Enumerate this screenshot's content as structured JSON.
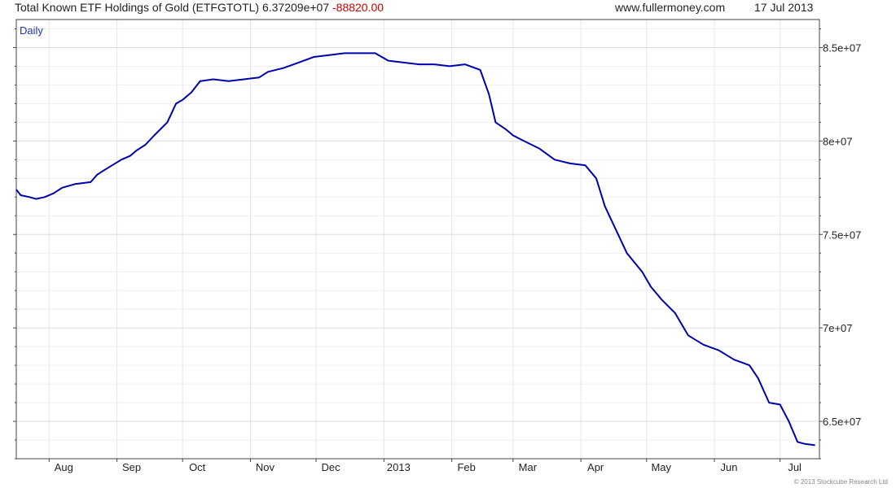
{
  "header": {
    "title": "Total Known ETF Holdings of Gold (ETFGTOTL)",
    "last_value": "6.37209e+07",
    "change": "-88820.00",
    "site": "www.fullermoney.com",
    "date": "17 Jul 2013"
  },
  "period_label": "Daily",
  "copyright": "© 2013 Stockcube Research Ltd",
  "colors": {
    "series": "#0000aa",
    "change": "#cc0000",
    "grid": "#e6e6e6",
    "axis": "#444444",
    "period_label": "#2233aa"
  },
  "chart_data": {
    "type": "line",
    "title": "Total Known ETF Holdings of Gold (ETFGTOTL)",
    "xlabel": "",
    "ylabel": "",
    "ylim": [
      63000000,
      86500000
    ],
    "xlim": [
      "2012-07-17",
      "2013-07-19"
    ],
    "y_axis_side": "right",
    "grid": true,
    "y_ticks": [
      {
        "value": 65000000,
        "label": "6.5e+07"
      },
      {
        "value": 70000000,
        "label": "7e+07"
      },
      {
        "value": 75000000,
        "label": "7.5e+07"
      },
      {
        "value": 80000000,
        "label": "8e+07"
      },
      {
        "value": 85000000,
        "label": "8.5e+07"
      }
    ],
    "x_ticks": [
      {
        "date": "2012-08-01",
        "label": "Aug"
      },
      {
        "date": "2012-09-01",
        "label": "Sep"
      },
      {
        "date": "2012-10-01",
        "label": "Oct"
      },
      {
        "date": "2012-11-01",
        "label": "Nov"
      },
      {
        "date": "2012-12-01",
        "label": "Dec"
      },
      {
        "date": "2013-01-01",
        "label": "2013"
      },
      {
        "date": "2013-02-01",
        "label": "Feb"
      },
      {
        "date": "2013-03-01",
        "label": "Mar"
      },
      {
        "date": "2013-04-01",
        "label": "Apr"
      },
      {
        "date": "2013-05-01",
        "label": "May"
      },
      {
        "date": "2013-06-01",
        "label": "Jun"
      },
      {
        "date": "2013-07-01",
        "label": "Jul"
      }
    ],
    "series": [
      {
        "x": [
          "2012-07-17",
          "2012-07-19",
          "2012-07-23",
          "2012-07-26",
          "2012-07-30",
          "2012-08-03",
          "2012-08-07",
          "2012-08-13",
          "2012-08-20",
          "2012-08-23",
          "2012-08-27",
          "2012-09-03",
          "2012-09-07",
          "2012-09-10",
          "2012-09-14",
          "2012-09-18",
          "2012-09-24",
          "2012-09-28",
          "2012-10-01",
          "2012-10-05",
          "2012-10-09",
          "2012-10-15",
          "2012-10-22",
          "2012-10-29",
          "2012-11-05",
          "2012-11-09",
          "2012-11-16",
          "2012-11-23",
          "2012-11-30",
          "2012-12-07",
          "2012-12-14",
          "2012-12-21",
          "2012-12-28",
          "2013-01-03",
          "2013-01-10",
          "2013-01-17",
          "2013-01-24",
          "2013-01-31",
          "2013-02-07",
          "2013-02-14",
          "2013-02-18",
          "2013-02-21",
          "2013-02-26",
          "2013-03-01",
          "2013-03-06",
          "2013-03-13",
          "2013-03-20",
          "2013-03-27",
          "2013-04-03",
          "2013-04-08",
          "2013-04-12",
          "2013-04-16",
          "2013-04-22",
          "2013-04-29",
          "2013-05-03",
          "2013-05-08",
          "2013-05-14",
          "2013-05-20",
          "2013-05-27",
          "2013-06-03",
          "2013-06-10",
          "2013-06-17",
          "2013-06-21",
          "2013-06-26",
          "2013-07-01",
          "2013-07-05",
          "2013-07-09",
          "2013-07-12",
          "2013-07-17"
        ],
        "y": [
          77400000,
          77100000,
          77000000,
          76900000,
          77000000,
          77200000,
          77500000,
          77700000,
          77800000,
          78200000,
          78500000,
          79000000,
          79200000,
          79500000,
          79800000,
          80300000,
          81000000,
          82000000,
          82200000,
          82600000,
          83200000,
          83300000,
          83200000,
          83300000,
          83400000,
          83700000,
          83900000,
          84200000,
          84500000,
          84600000,
          84700000,
          84700000,
          84700000,
          84300000,
          84200000,
          84100000,
          84100000,
          84000000,
          84100000,
          83800000,
          82500000,
          81000000,
          80600000,
          80300000,
          80000000,
          79600000,
          79000000,
          78800000,
          78700000,
          78000000,
          76500000,
          75500000,
          74000000,
          73000000,
          72200000,
          71500000,
          70800000,
          69600000,
          69100000,
          68800000,
          68300000,
          68000000,
          67300000,
          66000000,
          65900000,
          65000000,
          63900000,
          63800000,
          63720900
        ]
      }
    ]
  }
}
